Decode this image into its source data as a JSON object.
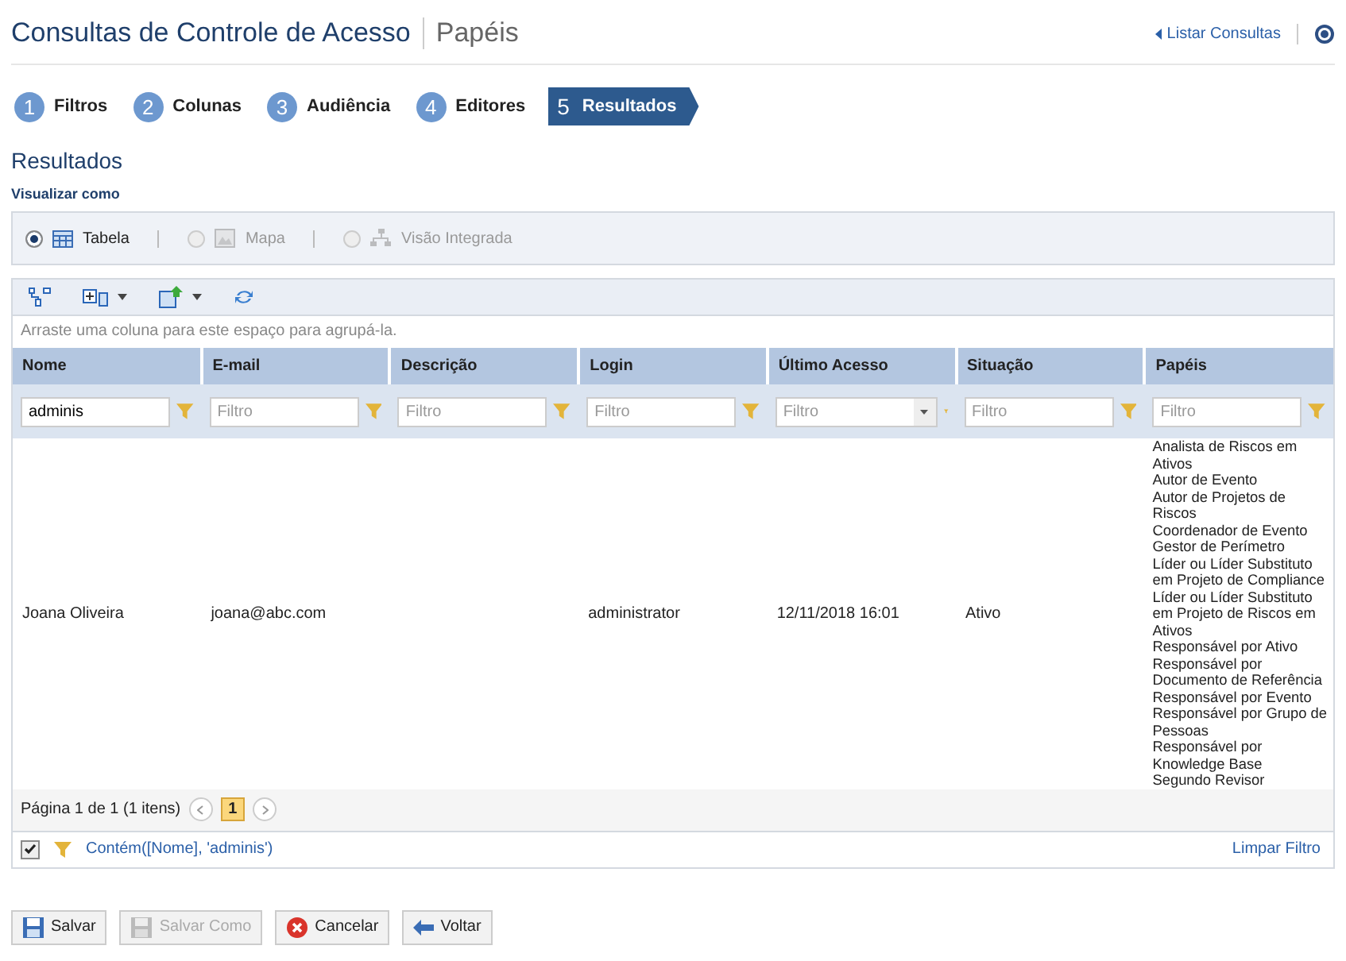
{
  "header": {
    "title": "Consultas de Controle de Acesso",
    "subtitle": "Papéis",
    "list_link": "Listar Consultas"
  },
  "steps": [
    {
      "number": "1",
      "label": "Filtros",
      "selected": false
    },
    {
      "number": "2",
      "label": "Colunas",
      "selected": false
    },
    {
      "number": "3",
      "label": "Audiência",
      "selected": false
    },
    {
      "number": "4",
      "label": "Editores",
      "selected": false
    },
    {
      "number": "5",
      "label": "Resultados",
      "selected": true
    }
  ],
  "section_title": "Resultados",
  "view_label": "Visualizar como",
  "view_options": [
    {
      "label": "Tabela",
      "selected": true,
      "disabled": false
    },
    {
      "label": "Mapa",
      "selected": false,
      "disabled": true
    },
    {
      "label": "Visão Integrada",
      "selected": false,
      "disabled": true
    }
  ],
  "group_hint": "Arraste uma coluna para este espaço para agrupá-la.",
  "table": {
    "columns": [
      "Nome",
      "E-mail",
      "Descrição",
      "Login",
      "Último Acesso",
      "Situação",
      "Papéis"
    ],
    "filters": [
      {
        "kind": "text",
        "value": "adminis"
      },
      {
        "kind": "text",
        "placeholder": "Filtro"
      },
      {
        "kind": "text",
        "placeholder": "Filtro"
      },
      {
        "kind": "text",
        "placeholder": "Filtro"
      },
      {
        "kind": "dropdown",
        "placeholder": "Filtro"
      },
      {
        "kind": "text",
        "placeholder": "Filtro"
      },
      {
        "kind": "text",
        "placeholder": "Filtro"
      }
    ],
    "rows": [
      {
        "cells": [
          "Joana Oliveira",
          "joana@abc.com",
          "",
          "administrator",
          "12/11/2018 16:01",
          "Ativo"
        ],
        "roles": [
          "Analista de Riscos em Ativos",
          "Autor de Evento",
          "Autor de Projetos de Riscos",
          "Coordenador de Evento",
          "Gestor de Perímetro",
          "Líder ou Líder Substituto em Projeto de Compliance",
          "Líder ou Líder Substituto em Projeto de Riscos em Ativos",
          "Responsável por Ativo",
          "Responsável por Documento de Referência",
          "Responsável por Evento",
          "Responsável por Grupo de Pessoas",
          "Responsável por Knowledge Base",
          "Segundo Revisor"
        ]
      }
    ]
  },
  "pager": {
    "summary": "Página 1 de 1 (1 itens)",
    "pages": [
      {
        "label": "1",
        "selected": true
      }
    ]
  },
  "filter_bar": {
    "checked": true,
    "expression": "Contém([Nome], 'adminis')",
    "clear": "Limpar Filtro"
  },
  "buttons": [
    {
      "kind": "save",
      "label": "Salvar",
      "disabled": false
    },
    {
      "kind": "save-as",
      "label": "Salvar Como",
      "disabled": true
    },
    {
      "kind": "cancel",
      "label": "Cancelar",
      "disabled": false
    },
    {
      "kind": "back",
      "label": "Voltar",
      "disabled": false
    }
  ]
}
